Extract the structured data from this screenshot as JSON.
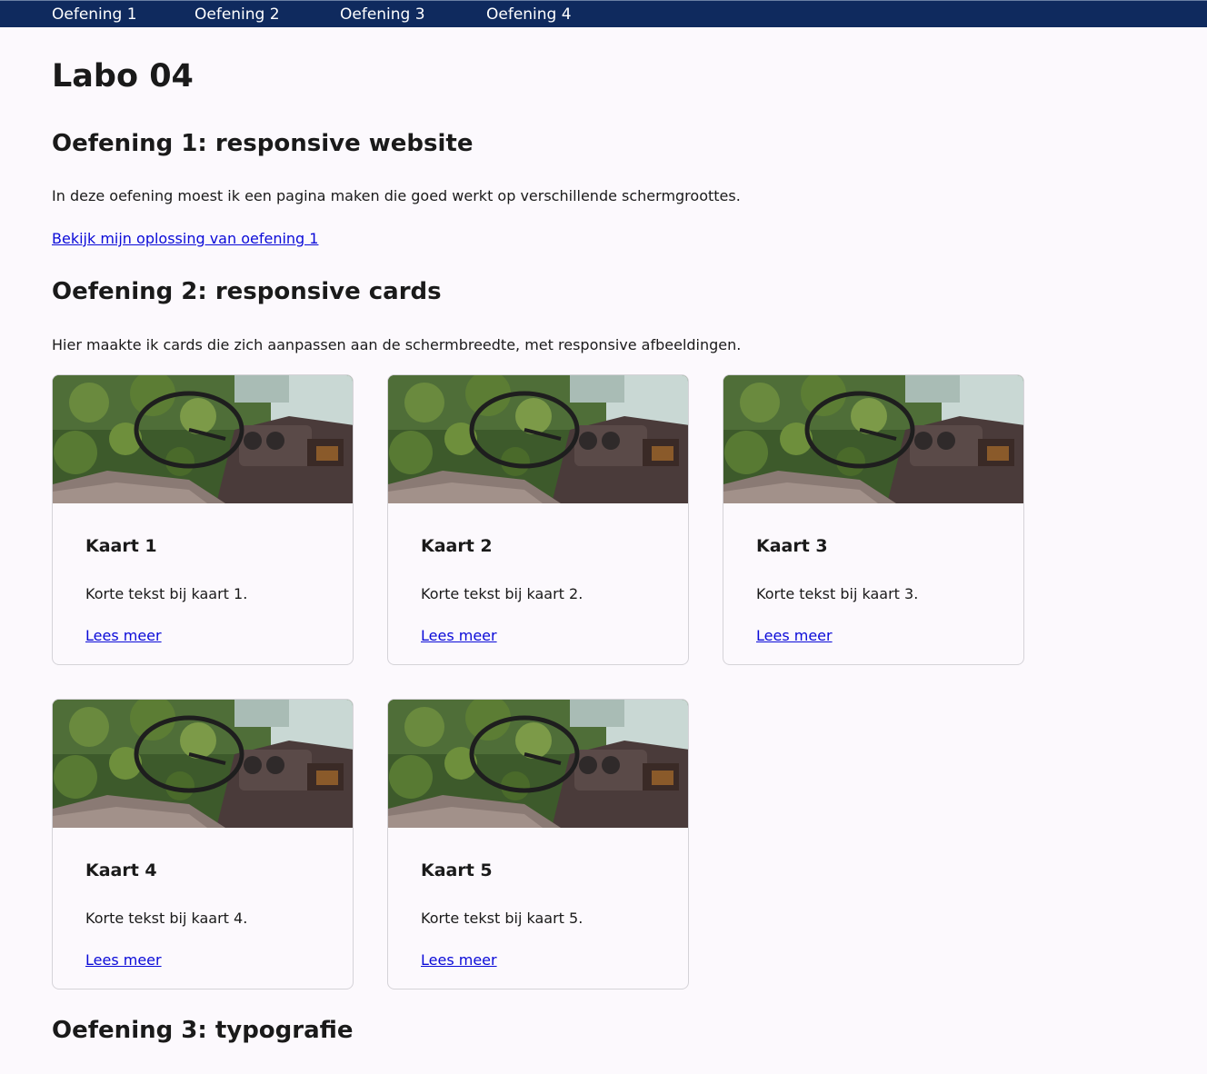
{
  "nav": {
    "items": [
      {
        "label": "Oefening 1"
      },
      {
        "label": "Oefening 2"
      },
      {
        "label": "Oefening 3"
      },
      {
        "label": "Oefening 4"
      }
    ]
  },
  "page": {
    "title": "Labo 04"
  },
  "section1": {
    "heading": "Oefening 1: responsive website",
    "text": "In deze oefening moest ik een pagina maken die goed werkt op verschillende schermgroottes.",
    "link": "Bekijk mijn oplossing van oefening 1"
  },
  "section2": {
    "heading": "Oefening 2: responsive cards",
    "text": "Hier maakte ik cards die zich aanpassen aan de schermbreedte, met responsive afbeeldingen.",
    "cards": [
      {
        "title": "Kaart 1",
        "text": "Korte tekst bij kaart 1.",
        "link": "Lees meer"
      },
      {
        "title": "Kaart 2",
        "text": "Korte tekst bij kaart 2.",
        "link": "Lees meer"
      },
      {
        "title": "Kaart 3",
        "text": "Korte tekst bij kaart 3.",
        "link": "Lees meer"
      },
      {
        "title": "Kaart 4",
        "text": "Korte tekst bij kaart 4.",
        "link": "Lees meer"
      },
      {
        "title": "Kaart 5",
        "text": "Korte tekst bij kaart 5.",
        "link": "Lees meer"
      }
    ]
  },
  "section3": {
    "heading": "Oefening 3: typografie"
  },
  "colors": {
    "nav_bg": "#0f2a5e",
    "page_bg": "#fcf9fd",
    "link": "#0a0ad8"
  }
}
